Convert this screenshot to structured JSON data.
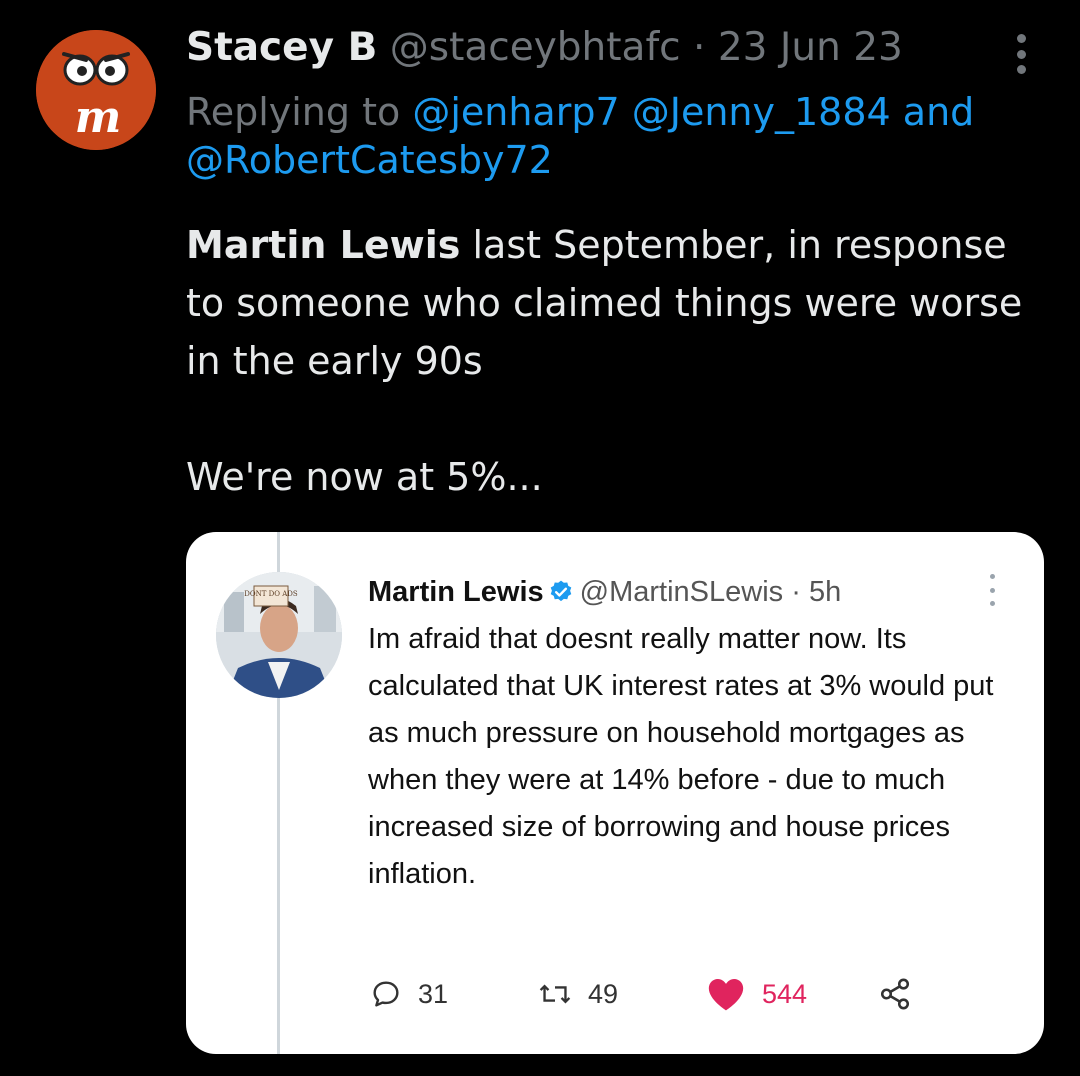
{
  "tweet": {
    "author_name": "Stacey B",
    "handle": "@staceybhtafc",
    "separator": "·",
    "date": "23 Jun 23",
    "replying_label": "Replying to",
    "reply_mention_1": "@jenharp7",
    "reply_mention_2": "@Jenny_1884",
    "reply_and": "and",
    "reply_mention_3": "@RobertCatesby72",
    "body_bold": "Martin Lewis",
    "body_rest": "last September, in response to someone who claimed things were worse in the early 90s",
    "body_line2": "We're now at 5%...",
    "avatar_letter": "m",
    "avatar_color": "#c8461a"
  },
  "quoted": {
    "name": "Martin Lewis",
    "handle": "@MartinSLewis",
    "separator": "·",
    "time": "5h",
    "text": "Im afraid that doesnt really matter now. Its calculated that UK interest rates at 3% would put as much pressure on household mortgages as when they were at 14% before - due to much increased size of borrowing and house prices inflation.",
    "avatar_badge": "DONT DO ADS",
    "verified_color": "#1d9bf0",
    "replies": "31",
    "retweets": "49",
    "likes": "544",
    "like_color": "#e0245e",
    "icons": [
      "reply-icon",
      "retweet-icon",
      "heart-icon",
      "share-icon"
    ]
  },
  "colors": {
    "background": "#000000",
    "text": "#e7e9ea",
    "muted": "#71767b",
    "link": "#1d9bf0"
  }
}
